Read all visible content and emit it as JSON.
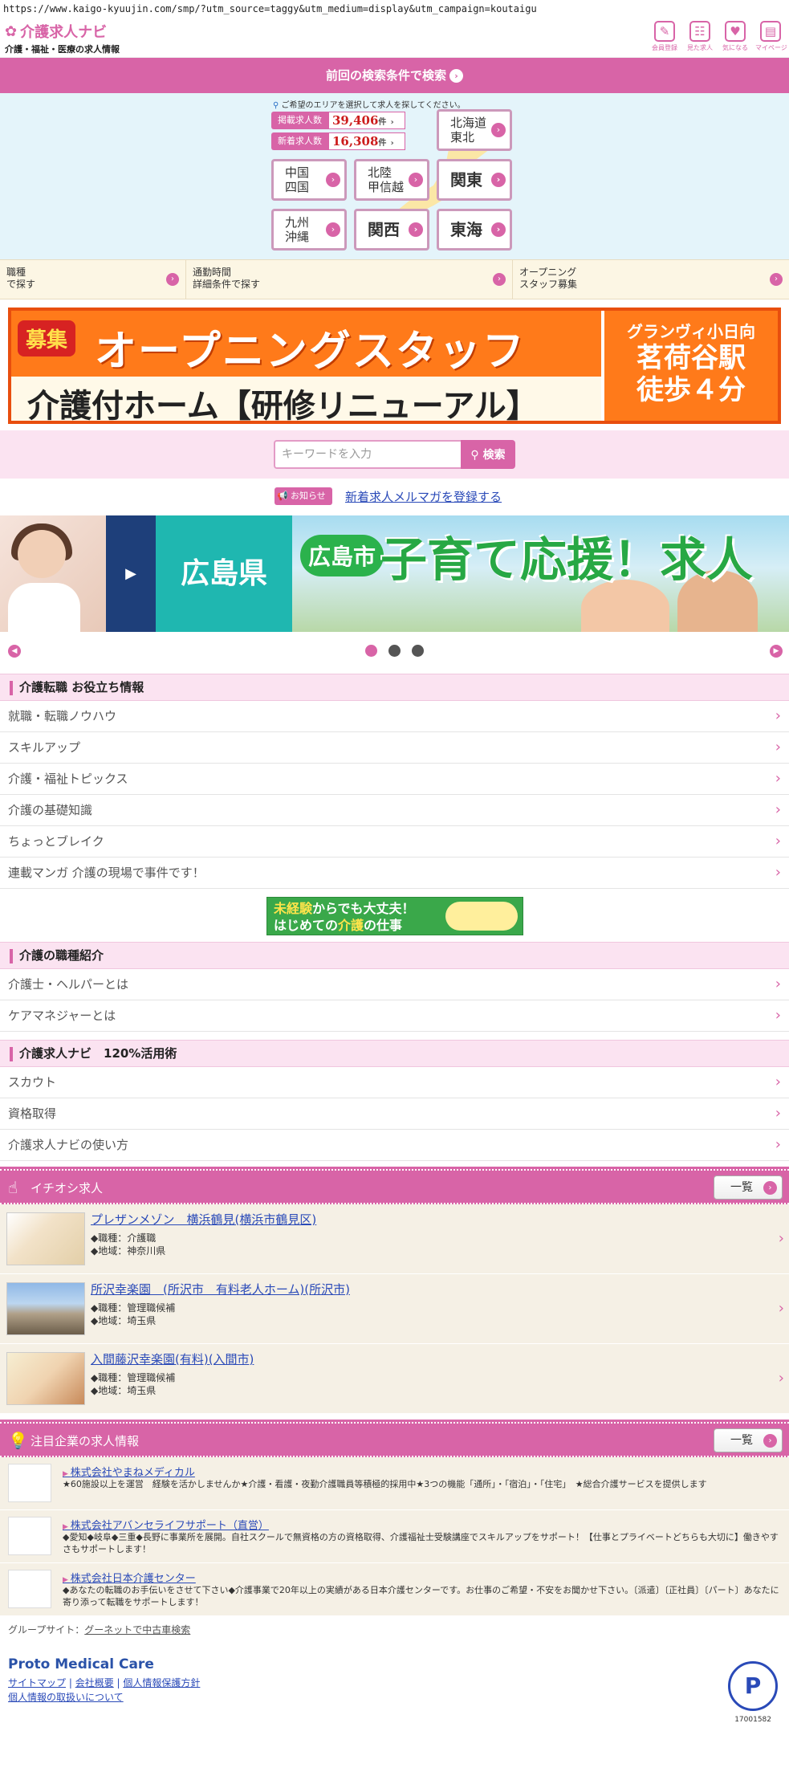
{
  "url": "https://www.kaigo-kyuujin.com/smp/?utm_source=taggy&utm_medium=display&utm_campaign=koutaigu",
  "header": {
    "logo_main": "介護求人ナビ",
    "logo_sub": "介護・福祉・医療の求人情報",
    "icons": [
      {
        "label": "会員登録",
        "icon": "pencil-icon",
        "glyph": "✎"
      },
      {
        "label": "見た求人",
        "icon": "calendar-icon",
        "glyph": "☷"
      },
      {
        "label": "気になる",
        "icon": "heart-icon",
        "glyph": "♥"
      },
      {
        "label": "マイページ",
        "icon": "book-icon",
        "glyph": "▤"
      }
    ]
  },
  "prev_search": "前回の検索条件で検索",
  "area": {
    "note": "ご希望のエリアを選択して求人を探してください。",
    "counts": [
      {
        "label": "掲載求人数",
        "value": "39,406",
        "unit": "件"
      },
      {
        "label": "新着求人数",
        "value": "16,308",
        "unit": "件"
      }
    ],
    "regions": [
      {
        "l1": "北海道",
        "l2": "東北"
      },
      {
        "l1": "中国",
        "l2": "四国"
      },
      {
        "l1": "北陸",
        "l2": "甲信越"
      },
      {
        "l1": "関東",
        "l2": ""
      },
      {
        "l1": "九州",
        "l2": "沖縄"
      },
      {
        "l1": "関西",
        "l2": ""
      },
      {
        "l1": "東海",
        "l2": ""
      }
    ]
  },
  "search_links": [
    {
      "l1": "職種",
      "l2": "で探す"
    },
    {
      "l1": "通勤時間",
      "l2": "詳細条件で探す"
    },
    {
      "l1": "オープニング",
      "l2": "スタッフ募集"
    }
  ],
  "banner": {
    "tag": "募集",
    "title": "オープニングスタッフ",
    "sub": "介護付ホーム【研修リニューアル】",
    "right1": "グランヴィ小日向",
    "right2": "茗荷谷駅",
    "right3": "徒歩４分"
  },
  "keyword": {
    "placeholder": "キーワードを入力",
    "button": "検索"
  },
  "notice": {
    "tag": "お知らせ",
    "link": "新着求人メルマガを登録する"
  },
  "slider": {
    "pref": "広島県",
    "city": "広島市",
    "text": "子育て応援！求人"
  },
  "section_useful": {
    "title": "介護転職 お役立ち情報",
    "items": [
      "就職・転職ノウハウ",
      "スキルアップ",
      "介護・福祉トピックス",
      "介護の基礎知識",
      "ちょっとブレイク",
      "連載マンガ 介護の現場で事件です！"
    ]
  },
  "mini_banner": {
    "line1a": "未経験",
    "line1b": "からでも大丈夫！",
    "line2a": "はじめての",
    "line2b": "介護",
    "line2c": "の仕事"
  },
  "section_jobs_intro": {
    "title": "介護の職種紹介",
    "items": [
      "介護士・ヘルパーとは",
      "ケアマネジャーとは"
    ]
  },
  "section_navi": {
    "title": "介護求人ナビ　120%活用術",
    "items": [
      "スカウト",
      "資格取得",
      "介護求人ナビの使い方"
    ]
  },
  "pickup": {
    "title": "イチオシ求人",
    "button": "一覧",
    "jobs": [
      {
        "title": "プレザンメゾン　横浜鶴見(横浜市鶴見区)",
        "type": "◆職種：介護職",
        "area": "◆地域：神奈川県"
      },
      {
        "title": "所沢幸楽園　(所沢市　有料老人ホーム)(所沢市)",
        "type": "◆職種：管理職候補",
        "area": "◆地域：埼玉県"
      },
      {
        "title": "入間藤沢幸楽園(有料)(入間市)",
        "type": "◆職種：管理職候補",
        "area": "◆地域：埼玉県"
      }
    ]
  },
  "companies": {
    "title": "注目企業の求人情報",
    "button": "一覧",
    "items": [
      {
        "name": "株式会社やまねメディカル",
        "desc": "★60施設以上を運営　経験を活かしませんか★介護・看護・夜勤介護職員等積極的採用中★3つの機能「通所」・「宿泊」・「住宅」　★総合介護サービスを提供します"
      },
      {
        "name": "株式会社アバンセライフサポート（直営）",
        "desc": "◆愛知◆岐阜◆三重◆長野に事業所を展開。自社スクールで無資格の方の資格取得、介護福祉士受験講座でスキルアップをサポート！【仕事とプライベートどちらも大切に】働きやすさもサポートします！"
      },
      {
        "name": "株式会社日本介護センター",
        "desc": "◆あなたの転職のお手伝いをさせて下さい◆介護事業で20年以上の実績がある日本介護センターです。お仕事のご希望・不安をお聞かせ下さい。〔派遣〕〔正社員〕〔パート〕あなたに寄り添って転職をサポートします！"
      }
    ]
  },
  "footer": {
    "group_label": "グループサイト：",
    "group_link": "グーネットで中古車検索",
    "brand": "Proto Medical Care",
    "links": [
      "サイトマップ",
      "会社概要",
      "個人情報保護方針",
      "個人情報の取扱いについて"
    ],
    "privacy_no": "17001582"
  },
  "colors": {
    "accent": "#d864a7",
    "link": "#2a4ab8"
  }
}
